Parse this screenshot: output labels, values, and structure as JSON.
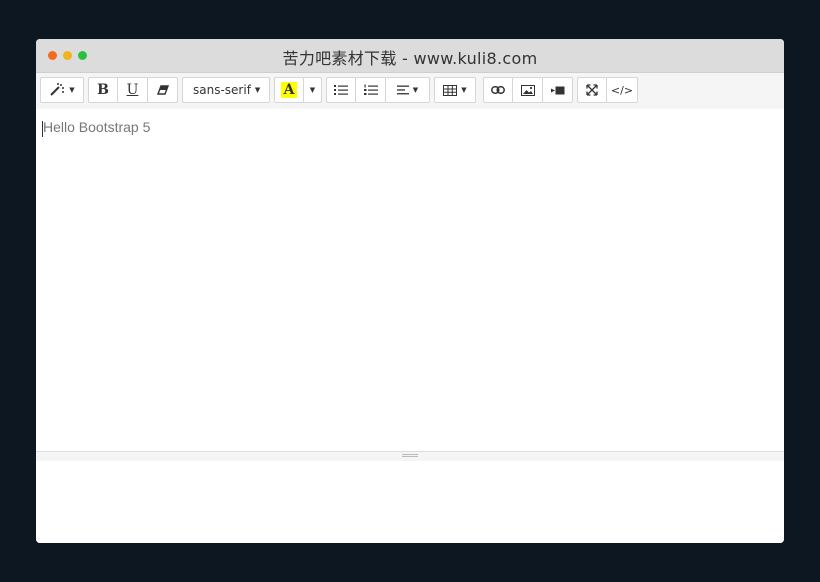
{
  "window": {
    "title": "苦力吧素材下载 - www.kuli8.com",
    "traffic_colors": [
      "#f46b1f",
      "#f2b31a",
      "#28c140"
    ]
  },
  "toolbar": {
    "style_label": "style",
    "bold_label": "B",
    "underline_label": "U",
    "font_name": "sans-serif",
    "color_label": "A",
    "color_highlight": "#ffff00",
    "code_label": "</>"
  },
  "editor": {
    "content": "Hello Bootstrap 5"
  },
  "icons": {
    "magic": "magic-wand-icon",
    "eraser": "eraser-icon",
    "ul": "unordered-list-icon",
    "ol": "ordered-list-icon",
    "align": "align-left-icon",
    "table": "table-icon",
    "link": "link-icon",
    "picture": "picture-icon",
    "video": "video-icon",
    "fullscreen": "fullscreen-icon"
  }
}
